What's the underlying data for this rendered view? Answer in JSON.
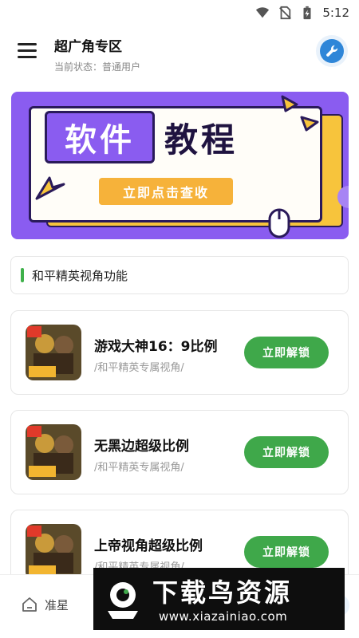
{
  "status_bar": {
    "time": "5:12",
    "icons": [
      "wifi-icon",
      "no-sim-icon",
      "battery-charging-icon"
    ]
  },
  "header": {
    "title": "超广角专区",
    "subtitle": "当前状态：普通用户",
    "menu_icon": "hamburger-menu-icon",
    "settings_icon": "wrench-icon",
    "accent": "#2f86d8"
  },
  "banner": {
    "tag_text": "软件",
    "title_text": "教程",
    "cta_text": "立即点击查收",
    "colors": {
      "background": "#8a5cf0",
      "card_back": "#f7c43c",
      "cta": "#f6b23a"
    }
  },
  "section": {
    "title": "和平精英视角功能",
    "accent": "#3fb14b"
  },
  "items": [
    {
      "title": "游戏大神16：9比例",
      "subtitle": "/和平精英专属视角/",
      "button": "立即解锁"
    },
    {
      "title": "无黑边超级比例",
      "subtitle": "/和平精英专属视角/",
      "button": "立即解锁"
    },
    {
      "title": "上帝视角超级比例",
      "subtitle": "/和平精英专属视角/",
      "button": "立即解锁"
    }
  ],
  "bottom_nav": {
    "items": [
      {
        "label": "准星",
        "icon": "home-icon"
      }
    ]
  },
  "watermark": {
    "title": "下载鸟资源",
    "url": "www.xiazainiao.com"
  },
  "button_color": "#3fa84a"
}
